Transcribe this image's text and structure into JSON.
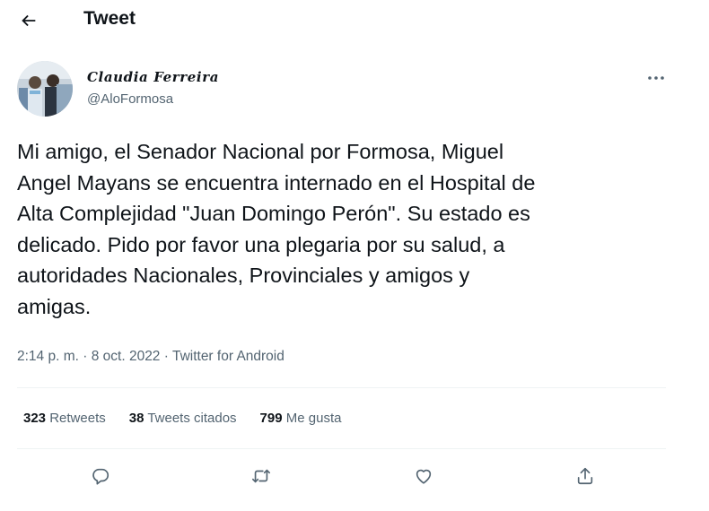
{
  "header": {
    "title": "Tweet",
    "back_icon": "arrow-left-icon"
  },
  "author": {
    "name": "Claudia Ferreira",
    "handle": "@AloFormosa"
  },
  "tweet": {
    "text": "Mi amigo, el Senador Nacional por Formosa, Miguel\nAngel Mayans se encuentra internado en el Hospital de\nAlta Complejidad \"Juan Domingo Perón\". Su estado es\ndelicado. Pido por favor una plegaria por su salud, a\nautoridades Nacionales, Provinciales y amigos y\namigas.",
    "time": "2:14 p. m.",
    "separator": "·",
    "date": "8 oct. 2022",
    "source": "Twitter for Android"
  },
  "stats": {
    "retweets_count": "323",
    "retweets_label": "Retweets",
    "quotes_count": "38",
    "quotes_label": "Tweets citados",
    "likes_count": "799",
    "likes_label": "Me gusta"
  },
  "actions": [
    "reply-icon",
    "retweet-icon",
    "like-icon",
    "share-icon"
  ],
  "colors": {
    "text": "#0f1419",
    "secondary": "#536471",
    "divider": "#eff3f4"
  }
}
